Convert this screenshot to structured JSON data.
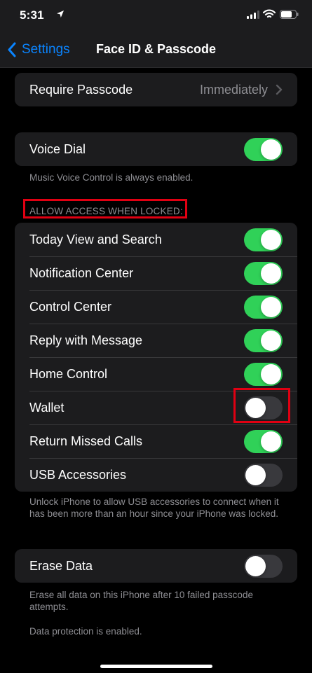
{
  "status": {
    "time": "5:31"
  },
  "nav": {
    "back_label": "Settings",
    "title": "Face ID & Passcode"
  },
  "require_passcode": {
    "label": "Require Passcode",
    "value": "Immediately"
  },
  "voice_dial": {
    "label": "Voice Dial",
    "on": true,
    "footer": "Music Voice Control is always enabled."
  },
  "locked_access": {
    "header": "ALLOW ACCESS WHEN LOCKED:",
    "items": [
      {
        "label": "Today View and Search",
        "on": true
      },
      {
        "label": "Notification Center",
        "on": true
      },
      {
        "label": "Control Center",
        "on": true
      },
      {
        "label": "Reply with Message",
        "on": true
      },
      {
        "label": "Home Control",
        "on": true
      },
      {
        "label": "Wallet",
        "on": false
      },
      {
        "label": "Return Missed Calls",
        "on": true
      },
      {
        "label": "USB Accessories",
        "on": false
      }
    ],
    "footer": "Unlock iPhone to allow USB accessories to connect when it has been more than an hour since your iPhone was locked."
  },
  "erase_data": {
    "label": "Erase Data",
    "on": false,
    "footer": "Erase all data on this iPhone after 10 failed passcode attempts.",
    "protection_note": "Data protection is enabled."
  },
  "colors": {
    "accent": "#0a84ff",
    "toggle_on": "#30d158",
    "toggle_off": "#39393d",
    "highlight": "#e00012"
  }
}
